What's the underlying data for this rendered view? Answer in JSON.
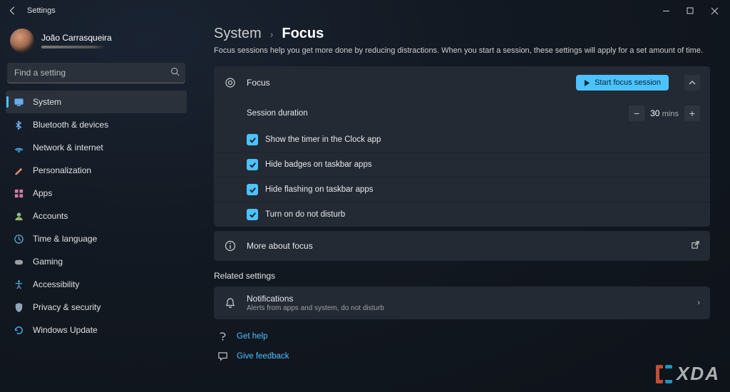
{
  "titlebar": {
    "back_aria": "Back",
    "title": "Settings"
  },
  "profile": {
    "name": "João Carrasqueira"
  },
  "search": {
    "placeholder": "Find a setting"
  },
  "nav": {
    "items": [
      {
        "label": "System",
        "icon": "system-icon",
        "color": "#6fb8ff",
        "active": true
      },
      {
        "label": "Bluetooth & devices",
        "icon": "bluetooth-icon",
        "color": "#6fb8ff"
      },
      {
        "label": "Network & internet",
        "icon": "network-icon",
        "color": "#3fa9e0"
      },
      {
        "label": "Personalization",
        "icon": "personalization-icon",
        "color": "#e08b6f"
      },
      {
        "label": "Apps",
        "icon": "apps-icon",
        "color": "#d77a9e"
      },
      {
        "label": "Accounts",
        "icon": "accounts-icon",
        "color": "#8fb870"
      },
      {
        "label": "Time & language",
        "icon": "time-language-icon",
        "color": "#5bb0e0"
      },
      {
        "label": "Gaming",
        "icon": "gaming-icon",
        "color": "#9e9e9e"
      },
      {
        "label": "Accessibility",
        "icon": "accessibility-icon",
        "color": "#4da5d8"
      },
      {
        "label": "Privacy & security",
        "icon": "privacy-icon",
        "color": "#8fa4b8"
      },
      {
        "label": "Windows Update",
        "icon": "update-icon",
        "color": "#3fa9e0"
      }
    ]
  },
  "breadcrumb": {
    "parent": "System",
    "current": "Focus"
  },
  "intro": "Focus sessions help you get more done by reducing distractions. When you start a session, these settings will apply for a set amount of time.",
  "focus": {
    "header_label": "Focus",
    "button_label": "Start focus session",
    "session_duration_label": "Session duration",
    "duration_value": "30",
    "duration_unit": "mins",
    "options": [
      {
        "label": "Show the timer in the Clock app",
        "checked": true
      },
      {
        "label": "Hide badges on taskbar apps",
        "checked": true
      },
      {
        "label": "Hide flashing on taskbar apps",
        "checked": true
      },
      {
        "label": "Turn on do not disturb",
        "checked": true
      }
    ]
  },
  "more": {
    "label": "More about focus"
  },
  "related": {
    "heading": "Related settings",
    "notifications": {
      "title": "Notifications",
      "subtitle": "Alerts from apps and system, do not disturb"
    }
  },
  "footer": {
    "help": "Get help",
    "feedback": "Give feedback"
  },
  "watermark": {
    "text": "XDA"
  },
  "colors": {
    "accent": "#4cc2ff"
  }
}
